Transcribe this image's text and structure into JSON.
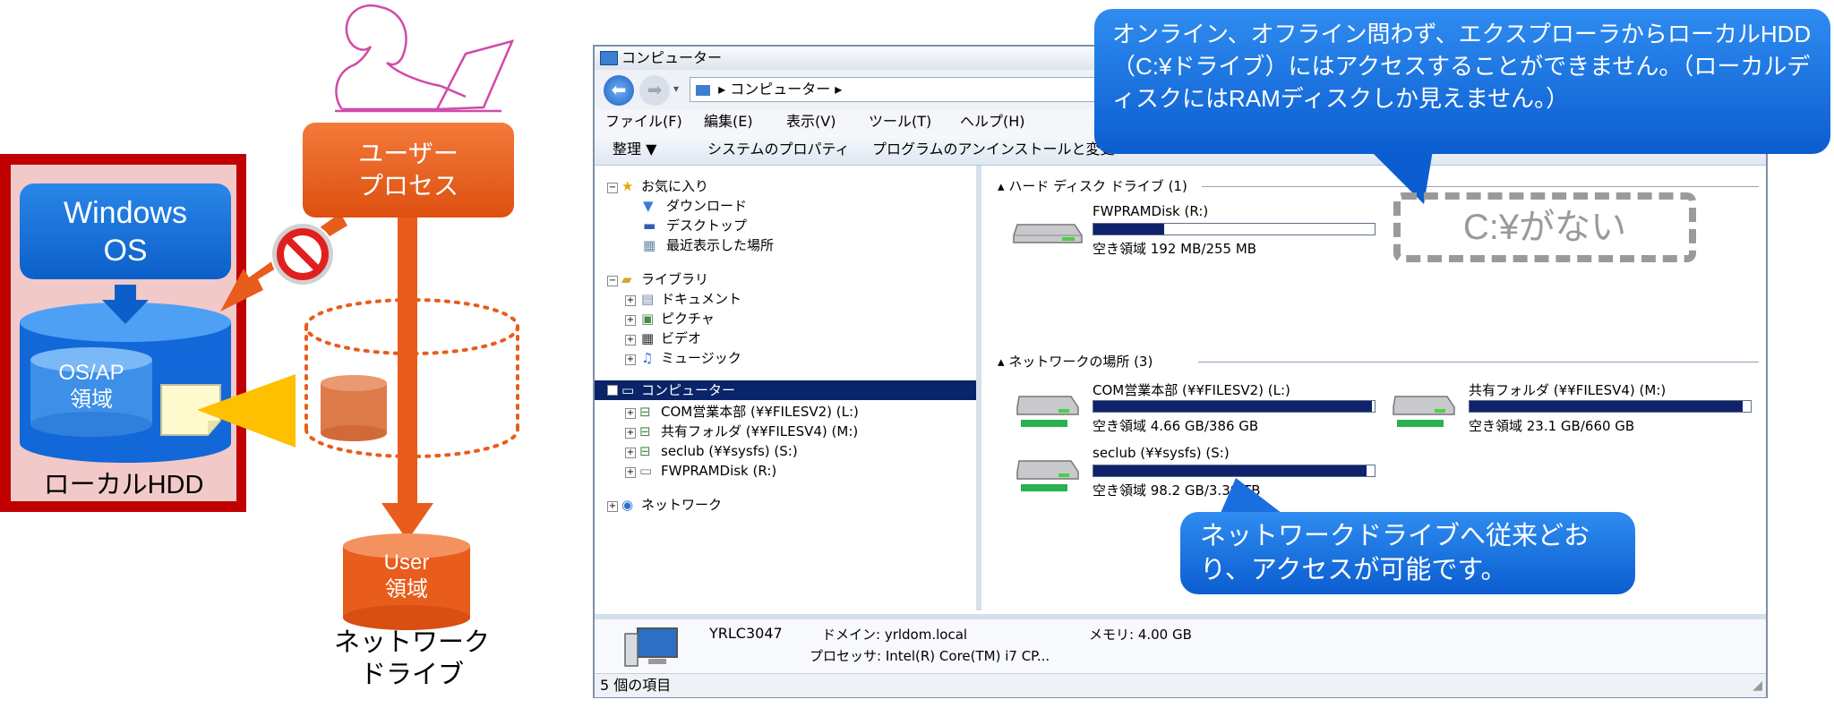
{
  "left": {
    "windows_os": "Windows\nOS",
    "os_ap_area": "OS/AP\n領域",
    "local_hdd": "ローカルHDD",
    "user_process": "ユーザー\nプロセス",
    "user_area": "User\n領域",
    "network_drive": "ネットワーク\nドライブ"
  },
  "explorer": {
    "title": "コンピューター",
    "address": "▸ コンピューター ▸",
    "menu": [
      "ファイル(F)",
      "編集(E)",
      "表示(V)",
      "ツール(T)",
      "ヘルプ(H)"
    ],
    "commands": [
      "整理 ▼",
      "システムのプロパティ",
      "プログラムのアンインストールと変更"
    ],
    "nav": {
      "favorites": "お気に入り",
      "favorites_items": [
        "ダウンロード",
        "デスクトップ",
        "最近表示した場所"
      ],
      "libraries": "ライブラリ",
      "libraries_items": [
        "ドキュメント",
        "ピクチャ",
        "ビデオ",
        "ミュージック"
      ],
      "computer": "コンピューター",
      "computer_items": [
        "COM営業本部 (¥¥FILESV2) (L:)",
        "共有フォルダ (¥¥FILESV4) (M:)",
        "seclub (¥¥sysfs) (S:)",
        "FWPRAMDisk (R:)"
      ],
      "network": "ネットワーク"
    },
    "hdd_group": "ハード ディスク ドライブ (1)",
    "network_group": "ネットワークの場所 (3)",
    "drives": [
      {
        "name": "FWPRAMDisk (R:)",
        "free": "空き領域 192 MB/255 MB",
        "used_fraction": 0.25
      },
      {
        "name": "COM営業本部 (¥¥FILESV2) (L:)",
        "free": "空き領域 4.66 GB/386 GB",
        "used_fraction": 0.99
      },
      {
        "name": "共有フォルダ (¥¥FILESV4) (M:)",
        "free": "空き領域 23.1 GB/660 GB",
        "used_fraction": 0.97
      },
      {
        "name": "seclub (¥¥sysfs) (S:)",
        "free": "空き領域 98.2 GB/3.39 TB",
        "used_fraction": 0.97
      }
    ],
    "details": {
      "computer_name": "YRLC3047",
      "domain": "ドメイン: yrldom.local",
      "memory": "メモリ: 4.00 GB",
      "processor": "プロセッサ: Intel(R) Core(TM) i7 CP..."
    },
    "status": "5 個の項目"
  },
  "callouts": {
    "top": "オンライン、オフライン問わず、エクスプローラからローカルHDD（C:¥ドライブ）にはアクセスすることができません。（ローカルディスクにはRAMディスクしか見えません。）",
    "no_c": "C:¥がない",
    "bottom": "ネットワークドライブへ従来どおり、アクセスが可能です。"
  },
  "colors": {
    "blue": "#0c5fc9",
    "orange": "#e85c1c",
    "red": "#c00000",
    "magenta": "#d04aa8",
    "yellow": "#ffc000",
    "navy_bar": "#10226b"
  }
}
